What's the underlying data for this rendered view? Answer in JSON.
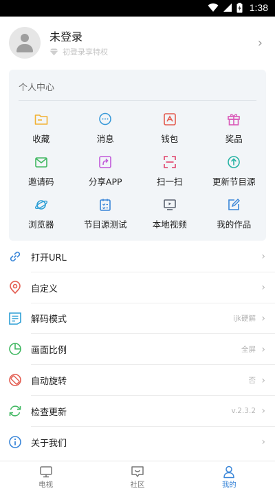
{
  "status_bar": {
    "time": "1:38"
  },
  "profile": {
    "name": "未登录",
    "subtitle": "初登录享特权"
  },
  "personal_center": {
    "title": "个人中心",
    "items": [
      {
        "label": "收藏",
        "icon": "folder-icon",
        "color": "#f2b233"
      },
      {
        "label": "消息",
        "icon": "message-icon",
        "color": "#3a9ad9"
      },
      {
        "label": "钱包",
        "icon": "wallet-icon",
        "color": "#e35b4f"
      },
      {
        "label": "奖品",
        "icon": "gift-icon",
        "color": "#d957b8"
      },
      {
        "label": "邀请码",
        "icon": "invite-envelope-icon",
        "color": "#3fb760"
      },
      {
        "label": "分享APP",
        "icon": "share-icon",
        "color": "#c15ad9"
      },
      {
        "label": "扫一扫",
        "icon": "scan-icon",
        "color": "#e0436b"
      },
      {
        "label": "更新节目源",
        "icon": "update-source-icon",
        "color": "#27b3a4"
      },
      {
        "label": "浏览器",
        "icon": "browser-planet-icon",
        "color": "#2e9fd6"
      },
      {
        "label": "节目源测试",
        "icon": "source-test-icon",
        "color": "#3a86d8"
      },
      {
        "label": "本地视频",
        "icon": "local-video-icon",
        "color": "#5a6270"
      },
      {
        "label": "我的作品",
        "icon": "my-works-icon",
        "color": "#3a86d8"
      }
    ]
  },
  "settings": [
    {
      "label": "打开URL",
      "value": "",
      "icon": "link-icon",
      "color": "#3a86d8"
    },
    {
      "label": "自定义",
      "value": "",
      "icon": "custom-pin-icon",
      "color": "#e35b4f"
    },
    {
      "label": "解码模式",
      "value": "ijk硬解",
      "icon": "decode-doc-icon",
      "color": "#2e9fd6"
    },
    {
      "label": "画面比例",
      "value": "全屏",
      "icon": "aspect-pie-icon",
      "color": "#3fb760"
    },
    {
      "label": "自动旋转",
      "value": "否",
      "icon": "rotate-icon",
      "color": "#e35b4f"
    },
    {
      "label": "检查更新",
      "value": "v.2.3.2",
      "icon": "refresh-icon",
      "color": "#3fb760"
    },
    {
      "label": "关于我们",
      "value": "",
      "icon": "info-icon",
      "color": "#3a86d8"
    }
  ],
  "tabs": [
    {
      "label": "电视",
      "active": false
    },
    {
      "label": "社区",
      "active": false
    },
    {
      "label": "我的",
      "active": true
    }
  ],
  "colors": {
    "accent": "#3a86d8",
    "card_bg": "#f2f5f8"
  }
}
